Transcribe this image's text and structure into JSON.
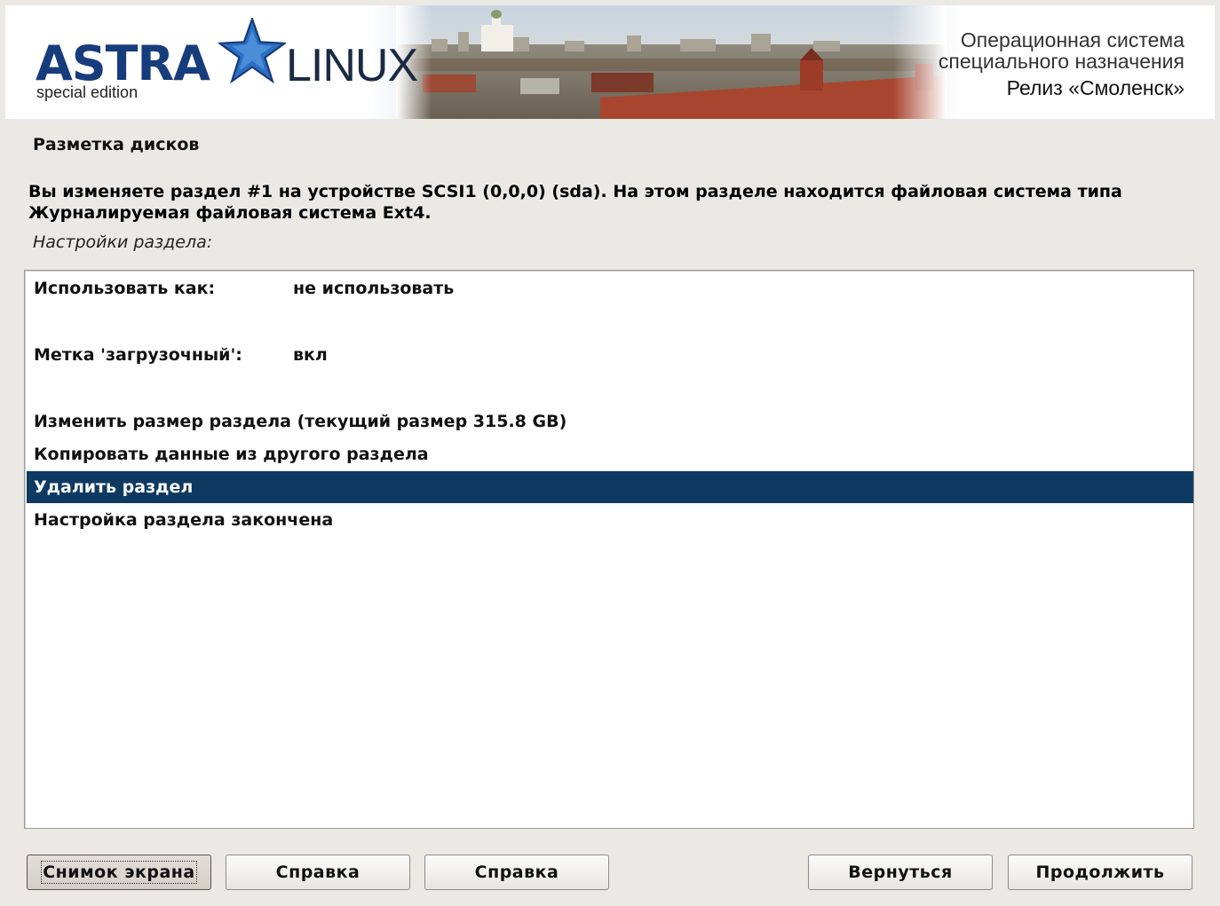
{
  "banner": {
    "logo_primary": "ASTRA",
    "logo_secondary": "LINUX",
    "logo_edition": "special edition",
    "tagline_line1": "Операционная система",
    "tagline_line2": "специального назначения",
    "release": "Релиз «Смоленск»",
    "star_icon": "star-icon",
    "colors": {
      "logo_blue": "#173c7c",
      "star_blue": "#2b6fc1"
    }
  },
  "section_title": "Разметка дисков",
  "description": "Вы изменяете раздел #1 на устройстве SCSI1 (0,0,0) (sda). На этом разделе находится файловая система типа Журналируемая файловая система Ext4.",
  "subtitle": "Настройки раздела:",
  "options": [
    {
      "label": "Использовать как:",
      "value": "не использовать",
      "selected": false
    },
    {
      "label": "Метка 'загрузочный':",
      "value": "вкл",
      "selected": false
    },
    {
      "label": "Изменить размер раздела (текущий размер 315.8 GB)",
      "value": "",
      "selected": false
    },
    {
      "label": "Копировать данные из другого раздела",
      "value": "",
      "selected": false
    },
    {
      "label": "Удалить раздел",
      "value": "",
      "selected": true
    },
    {
      "label": "Настройка раздела закончена",
      "value": "",
      "selected": false
    }
  ],
  "buttons": {
    "screenshot": "Снимок экрана",
    "help1": "Справка",
    "help2": "Справка",
    "back": "Вернуться",
    "continue": "Продолжить"
  },
  "colors": {
    "selection_bg": "#0e3a62",
    "window_bg": "#ebe9e4"
  }
}
